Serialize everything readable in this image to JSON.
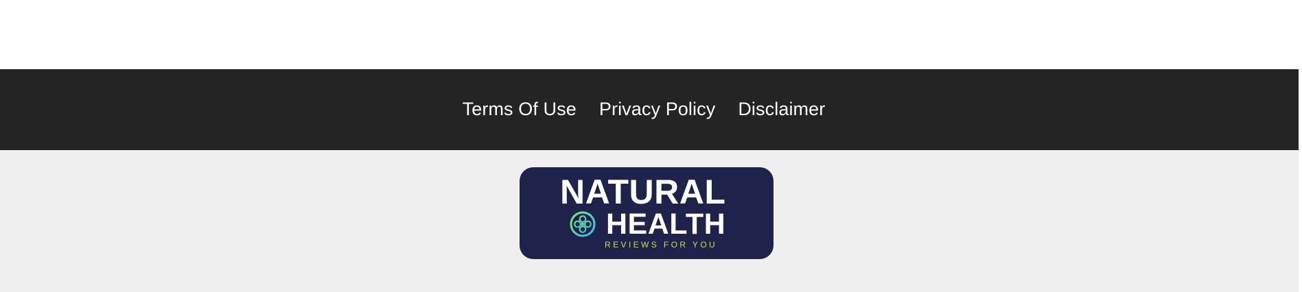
{
  "footer_nav": {
    "links": [
      {
        "label": "Terms Of Use"
      },
      {
        "label": "Privacy Policy"
      },
      {
        "label": "Disclaimer"
      }
    ]
  },
  "logo": {
    "line1": "NATURAL",
    "line2": "HEALTH",
    "tagline": "REVIEWS FOR YOU",
    "emblem_icon": "medical-cross-circle-icon"
  },
  "colors": {
    "nav_background": "#242424",
    "logo_background": "#1f224a",
    "logo_band_background": "#efefef",
    "tagline": "#b7e84a",
    "emblem_gradient_start": "#7ee07a",
    "emblem_gradient_end": "#38b7e8"
  }
}
